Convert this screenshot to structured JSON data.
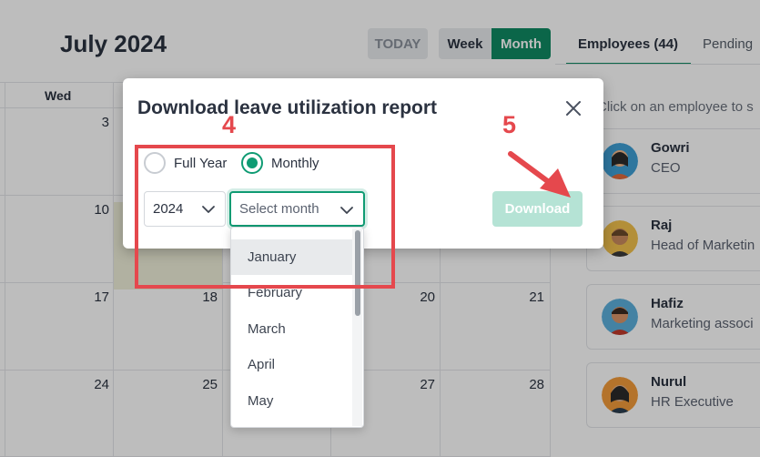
{
  "header": {
    "title": "July 2024",
    "today_label": "TODAY",
    "week_label": "Week",
    "month_label": "Month"
  },
  "tabs": {
    "employees": "Employees (44)",
    "pending": "Pending"
  },
  "hint": "Click on an employee to s",
  "calendar": {
    "day_header": "Wed",
    "dates": [
      "3",
      "10",
      "17",
      "18",
      "20",
      "21",
      "24",
      "25",
      "27",
      "28"
    ]
  },
  "employees": [
    {
      "name": "Gowri",
      "role": "CEO"
    },
    {
      "name": "Raj",
      "role": "Head of Marketin"
    },
    {
      "name": "Hafiz",
      "role": "Marketing associ"
    },
    {
      "name": "Nurul",
      "role": "HR Executive"
    }
  ],
  "modal": {
    "title": "Download leave utilization report",
    "option_full_year": "Full Year",
    "option_monthly": "Monthly",
    "year_value": "2024",
    "month_placeholder": "Select month",
    "download_label": "Download",
    "months": [
      "January",
      "February",
      "March",
      "April",
      "May"
    ]
  },
  "annotations": {
    "step_a": "4",
    "step_b": "5"
  },
  "colors": {
    "accent": "#0f8a63",
    "annotation": "#e5484d"
  }
}
